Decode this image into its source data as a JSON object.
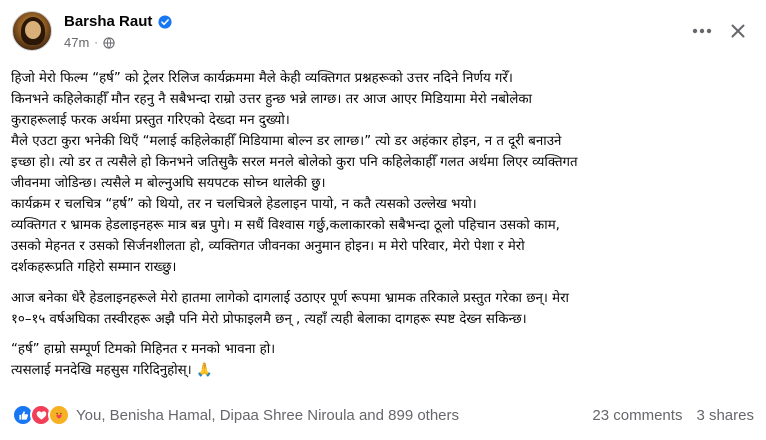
{
  "post": {
    "author": "Barsha Raut",
    "time": "47m",
    "lines": [
      "हिजो मेरो फिल्म “हर्ष” को ट्रेलर रिलिज कार्यक्रममा मैले केही व्यक्तिगत प्रश्नहरूको उत्तर नदिने निर्णय गरेँ।",
      "किनभने कहिलेकाहीँ मौन रहनु नै सबैभन्दा राम्रो उत्तर हुन्छ भन्ने लाग्छ। तर आज आएर मिडियामा मेरो नबोलेका",
      "कुराहरूलाई फरक अर्थमा प्रस्तुत गरिएको देख्दा मन दुख्यो।",
      "मैले एउटा कुरा भनेकी थिएँ  “मलाई कहिलेकाहीँ मिडियामा बोल्न डर लाग्छ।” त्यो डर अहंकार होइन, न त दूरी बनाउने",
      "इच्छा हो। त्यो डर त त्यसैले हो किनभने जतिसुकै सरल मनले बोलेको कुरा पनि कहिलेकाहीँ गलत अर्थमा लिएर व्यक्तिगत",
      "जीवनमा जोडिन्छ। त्यसैले म बोल्नुअघि सयपटक सोच्न थालेकी छु।",
      "कार्यक्रम र चलचित्र “हर्ष” को थियो, तर न चलचित्रले हेडलाइन पायो, न कतै त्यसको उल्लेख भयो।",
      "व्यक्तिगत र भ्रामक हेडलाइनहरू मात्र बन्न पुगे। म सधैं विश्वास गर्छु,कलाकारको सबैभन्दा ठूलो पहिचान उसको काम,",
      "उसको मेहनत र उसको सिर्जनशीलता हो, व्यक्तिगत जीवनका अनुमान होइन। म मेरो परिवार, मेरो पेशा र मेरो",
      "दर्शकहरूप्रति गहिरो सम्मान राख्छु।",
      "आज बनेका धेरै हेडलाइनहरूले मेरो हातमा लागेको दागलाई उठाएर पूर्ण रूपमा भ्रामक तरिकाले प्रस्तुत गरेका छन्। मेरा",
      "१०–१५ वर्षअघिका तस्वीरहरू अझै पनि मेरो प्रोफाइलमै छन् , त्यहाँ त्यही बेलाका दागहरू स्पष्ट देख्न सकिन्छ।",
      "“हर्ष” हाम्रो सम्पूर्ण टिमको मिहिनत र मनको भावना हो।",
      "त्यसलाई मनदेखि महसुस गरिदिनुहोस्। 🙏"
    ]
  },
  "reactions": {
    "summary": "You, Benisha Hamal, Dipaa Shree Niroula and 899 others",
    "comments": "23 comments",
    "shares": "3 shares"
  },
  "icons": {
    "verified": "verified-badge-icon",
    "privacy": "globe-icon",
    "more": "more-options-icon",
    "close": "close-icon",
    "like": "like-reaction-icon",
    "love": "love-reaction-icon",
    "care": "care-reaction-icon"
  },
  "colors": {
    "accent": "#1877f2",
    "love": "#f33e58",
    "care": "#f7b125",
    "secondary_text": "#65676b"
  }
}
